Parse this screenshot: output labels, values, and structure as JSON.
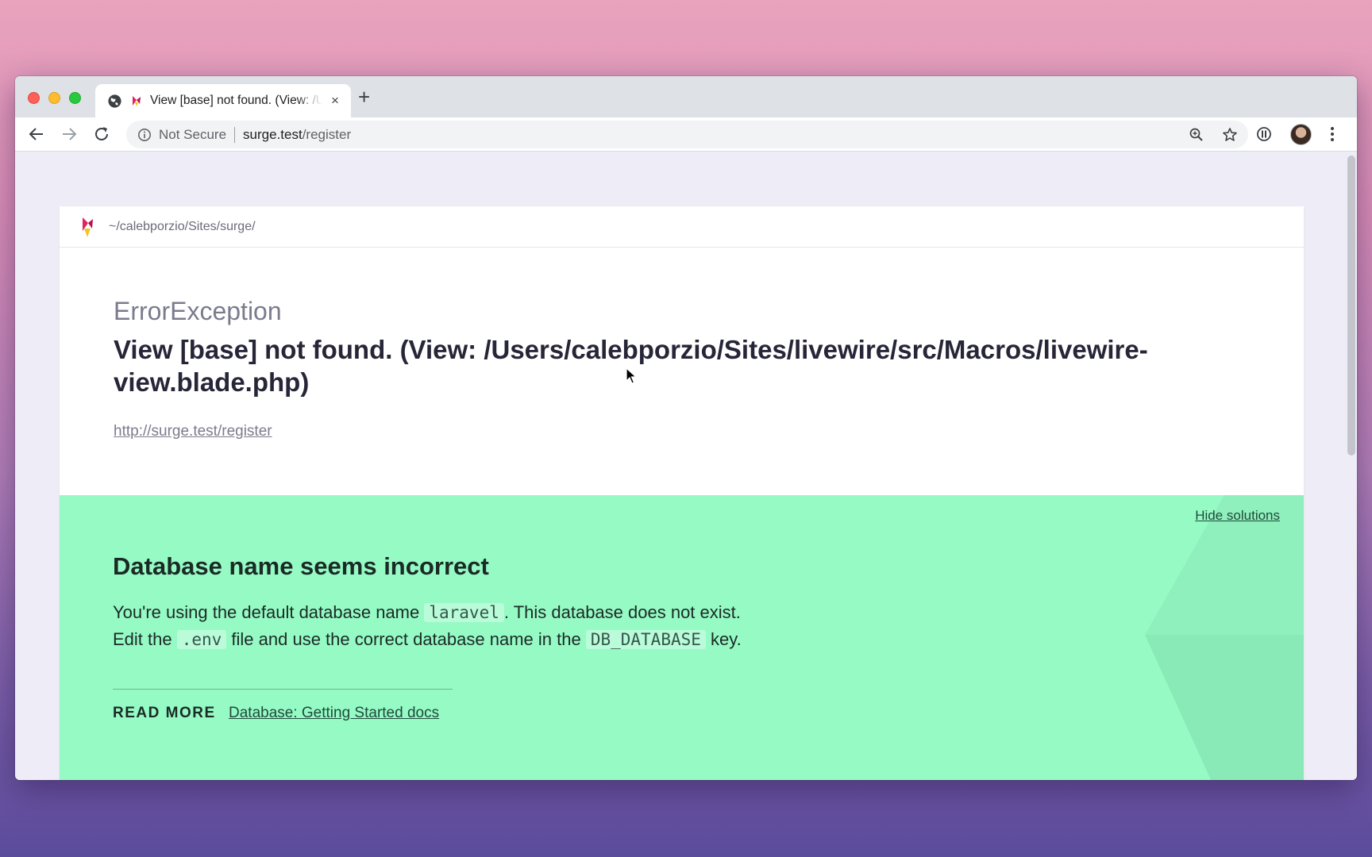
{
  "browser": {
    "tab_title": "View [base] not found. (View: /Users/calebporzio/Sites/livewire/src/Macros/livewire-view.blade.php)",
    "tab_close": "×",
    "new_tab": "+",
    "security_label": "Not Secure",
    "url_host": "surge.test",
    "url_path": "/register"
  },
  "page": {
    "project_path": "~/calebporzio/Sites/surge/",
    "exception_type": "ErrorException",
    "exception_message": "View [base] not found. (View: /Users/calebporzio/Sites/livewire/src/Macros/livewire-view.blade.php)",
    "request_url": "http://surge.test/register"
  },
  "solution": {
    "hide_label": "Hide solutions",
    "title": "Database name seems incorrect",
    "line1_pre": "You're using the default database name ",
    "line1_code": "laravel",
    "line1_post": ". This database does not exist.",
    "line2_pre": "Edit the ",
    "line2_code": ".env",
    "line2_mid": " file and use the correct database name in the ",
    "line2_code2": "DB_DATABASE",
    "line2_post": " key.",
    "read_more_label": "READ MORE",
    "doc_link": "Database: Getting Started docs"
  },
  "colors": {
    "solution_bg": "#96fac5",
    "not_secure": "#5f6368",
    "close_red": "#fe5f57",
    "minimize_yellow": "#febc2e",
    "zoom_green": "#28c840"
  },
  "icons": [
    "globe-icon",
    "ignition-favicon",
    "close-icon",
    "plus-icon",
    "back-arrow-icon",
    "forward-arrow-icon",
    "reload-icon",
    "info-icon",
    "zoom-icon",
    "star-icon",
    "password-manager-icon",
    "avatar",
    "kebab-menu-icon",
    "ignition-logo"
  ]
}
